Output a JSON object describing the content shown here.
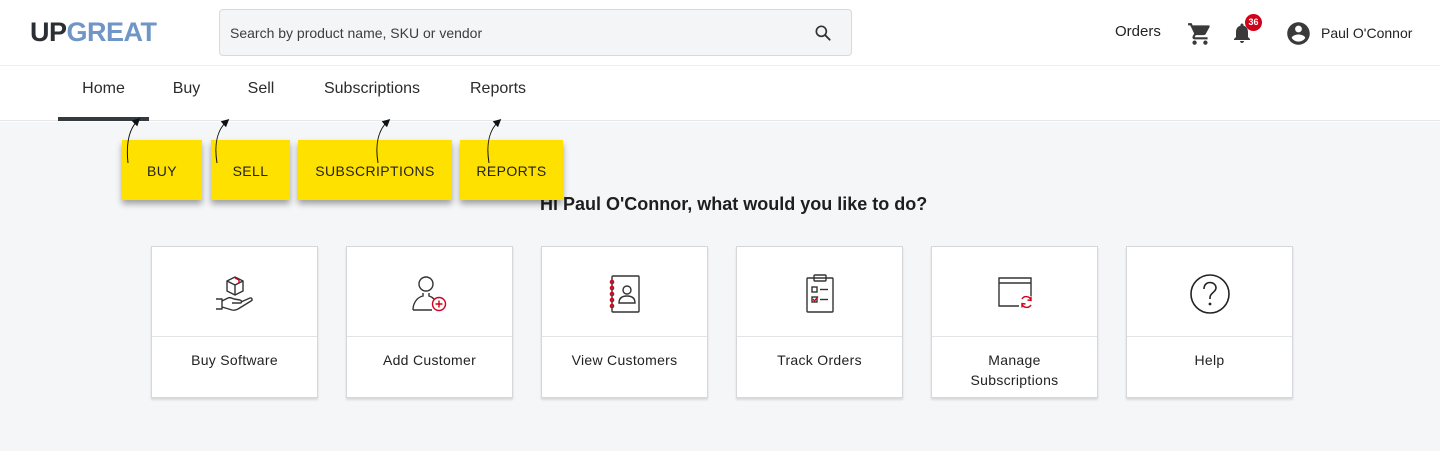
{
  "header": {
    "logo_part1": "UP",
    "logo_part2": "GREAT",
    "search_placeholder": "Search by product name, SKU or vendor",
    "search_icon": "search-icon",
    "orders_label": "Orders",
    "cart_icon": "cart-icon",
    "bell_icon": "bell-icon",
    "notification_count": "36",
    "avatar_icon": "account-circle-icon",
    "user_name": "Paul O'Connor"
  },
  "nav": {
    "tabs": [
      {
        "label": "Home",
        "active": true
      },
      {
        "label": "Buy",
        "active": false
      },
      {
        "label": "Sell",
        "active": false
      },
      {
        "label": "Subscriptions",
        "active": false
      },
      {
        "label": "Reports",
        "active": false
      }
    ]
  },
  "callouts": [
    "BUY",
    "SELL",
    "SUBSCRIPTIONS",
    "REPORTS"
  ],
  "main": {
    "greeting": "Hi Paul O'Connor, what would you like to do?",
    "cards": [
      {
        "label": "Buy Software",
        "icon": "box-in-hand-icon"
      },
      {
        "label": "Add Customer",
        "icon": "add-person-icon"
      },
      {
        "label": "View Customers",
        "icon": "contact-book-icon"
      },
      {
        "label": "Track Orders",
        "icon": "clipboard-checklist-icon"
      },
      {
        "label": "Manage Subscriptions",
        "icon": "window-refresh-icon"
      },
      {
        "label": "Help",
        "icon": "question-circle-icon"
      }
    ]
  },
  "colors": {
    "accent_red": "#d0021b",
    "callout_yellow": "#ffe100",
    "logo_blue": "#6f96c6",
    "active_tab_underline": "#333a40"
  }
}
